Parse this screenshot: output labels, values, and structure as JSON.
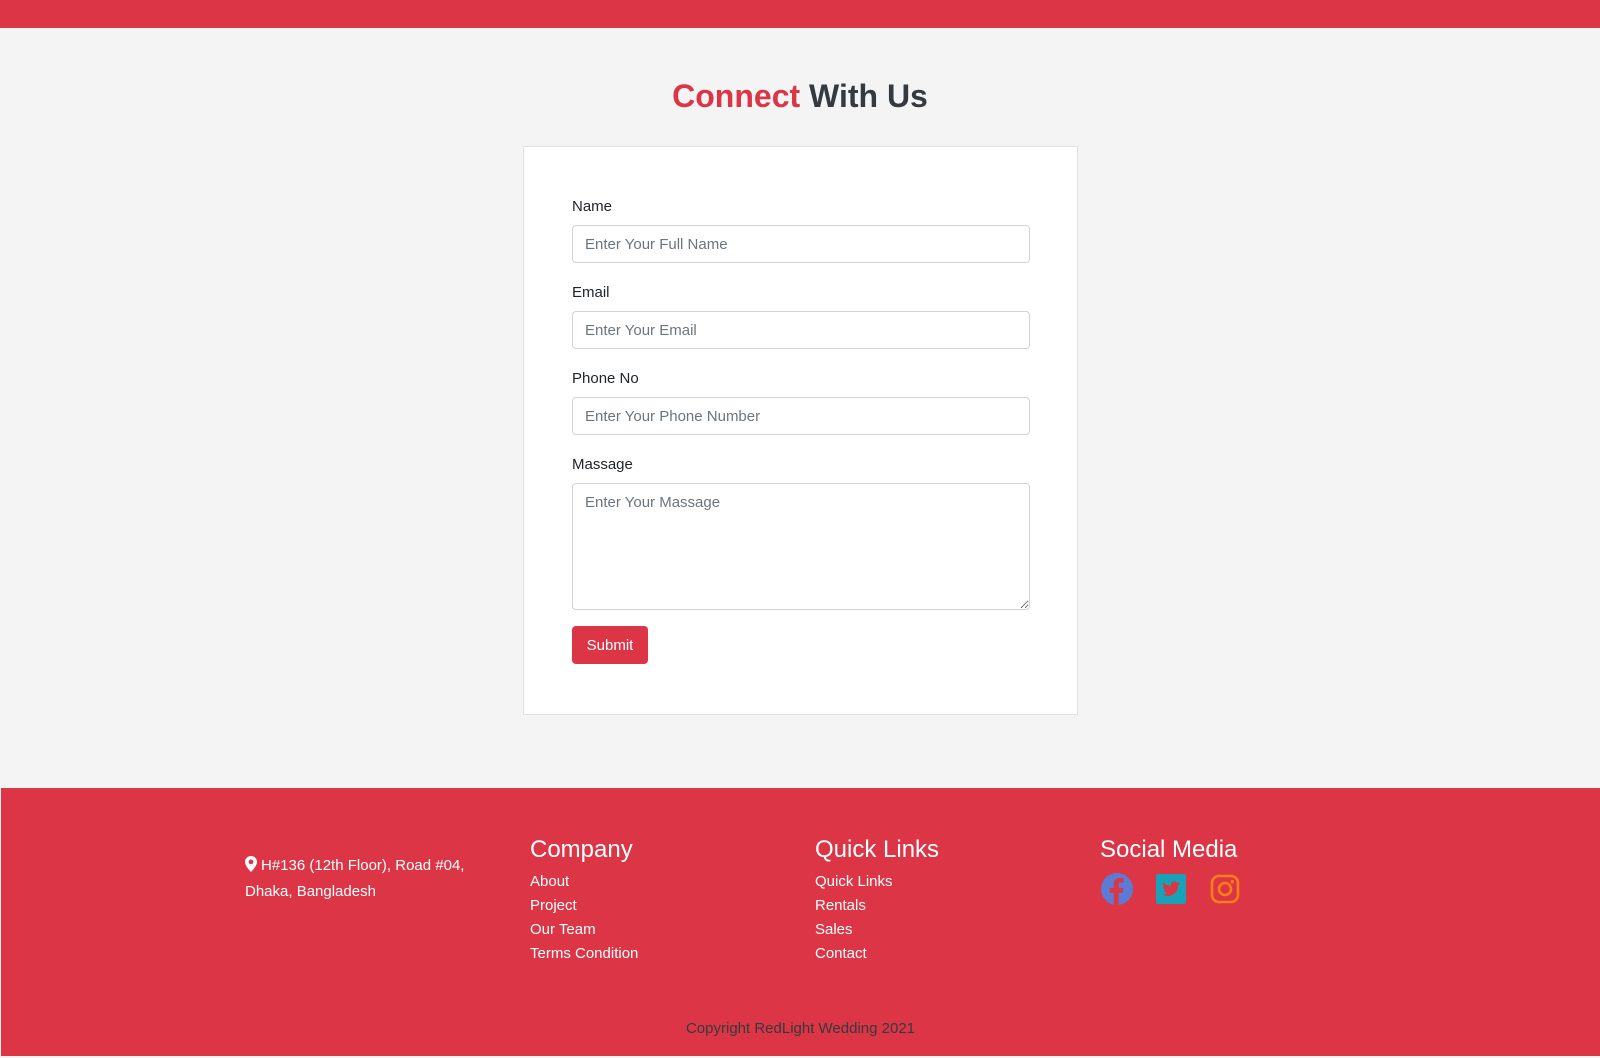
{
  "heading": {
    "accent": "Connect",
    "rest": "With Us"
  },
  "form": {
    "name_label": "Name",
    "name_placeholder": "Enter Your Full Name",
    "email_label": "Email",
    "email_placeholder": "Enter Your Email",
    "phone_label": "Phone No",
    "phone_placeholder": "Enter Your Phone Number",
    "message_label": "Massage",
    "message_placeholder": "Enter Your Massage",
    "submit_label": "Submit"
  },
  "footer": {
    "address_line1": "H#136 (12th Floor), Road #04,",
    "address_line2": "Dhaka, Bangladesh",
    "company": {
      "title": "Company",
      "items": [
        "About",
        "Project",
        "Our Team",
        "Terms Condition"
      ]
    },
    "quick_links": {
      "title": "Quick Links",
      "items": [
        "Quick Links",
        "Rentals",
        "Sales",
        "Contact"
      ]
    },
    "social": {
      "title": "Social Media",
      "icons": [
        "facebook-icon",
        "twitter-icon",
        "instagram-icon"
      ]
    },
    "copyright": "Copyright RedLight Wedding 2021"
  },
  "colors": {
    "brand_red": "#dc3545",
    "dark_text": "#343a40",
    "page_bg": "#f4f4f4",
    "facebook": "#5b7bd5",
    "twitter": "#17a2b8",
    "instagram": "#fd7e14"
  }
}
